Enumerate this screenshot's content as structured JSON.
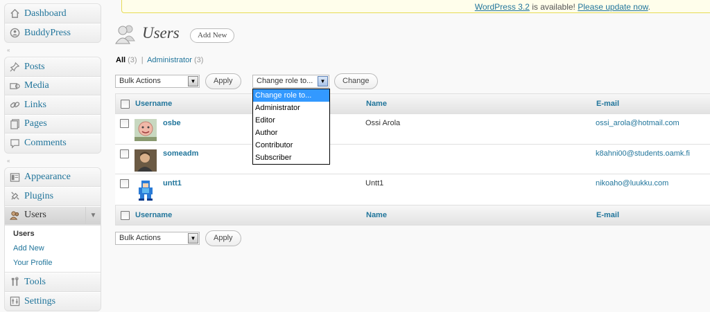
{
  "update_nag": {
    "version_link": "WordPress 3.2",
    "middle": " is available! ",
    "update_link": "Please update now",
    "end": "."
  },
  "sidebar": {
    "group1": [
      {
        "label": "Dashboard",
        "icon": "dashboard-icon"
      },
      {
        "label": "BuddyPress",
        "icon": "buddypress-icon"
      }
    ],
    "group2": [
      {
        "label": "Posts",
        "icon": "pin-icon"
      },
      {
        "label": "Media",
        "icon": "media-icon"
      },
      {
        "label": "Links",
        "icon": "link-icon"
      },
      {
        "label": "Pages",
        "icon": "pages-icon"
      },
      {
        "label": "Comments",
        "icon": "comment-icon"
      }
    ],
    "group3": [
      {
        "label": "Appearance",
        "icon": "appearance-icon"
      },
      {
        "label": "Plugins",
        "icon": "plugin-icon"
      },
      {
        "label": "Users",
        "icon": "users-icon"
      },
      {
        "label": "Tools",
        "icon": "tools-icon"
      },
      {
        "label": "Settings",
        "icon": "settings-icon"
      }
    ],
    "users_submenu": [
      "Users",
      "Add New",
      "Your Profile"
    ]
  },
  "header": {
    "title": "Users",
    "add_new": "Add New"
  },
  "views": {
    "all": "All",
    "all_count": "(3)",
    "separator": "|",
    "admin": "Administrator",
    "admin_count": "(3)"
  },
  "controls": {
    "bulk_actions": "Bulk Actions",
    "apply": "Apply",
    "change_role": "Change role to...",
    "change": "Change"
  },
  "role_options": [
    "Change role to...",
    "Administrator",
    "Editor",
    "Author",
    "Contributor",
    "Subscriber"
  ],
  "table": {
    "columns": [
      "Username",
      "Name",
      "E-mail"
    ],
    "rows": [
      {
        "username": "osbe",
        "name": "Ossi Arola",
        "email": "ossi_arola@hotmail.com"
      },
      {
        "username": "someadm",
        "name": "",
        "email": "k8ahni00@students.oamk.fi"
      },
      {
        "username": "untt1",
        "name": "Untt1",
        "email": "nikoaho@luukku.com"
      }
    ]
  },
  "colors": {
    "link": "#21759b",
    "selected": "#3399ff",
    "nag_bg": "#fffeeb"
  }
}
